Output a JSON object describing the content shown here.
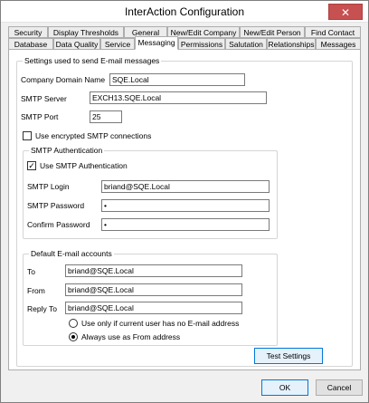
{
  "window": {
    "title": "InterAction Configuration",
    "close_glyph": "✕"
  },
  "tabs_row1": [
    "Security",
    "Display Thresholds",
    "General",
    "New/Edit Company",
    "New/Edit Person",
    "Find Contact"
  ],
  "tabs_row2": [
    "Database",
    "Data Quality",
    "Service",
    "Messaging",
    "Permissions",
    "Salutation",
    "Relationships",
    "Messages"
  ],
  "active_tab": "Messaging",
  "email_settings": {
    "legend": "Settings used to send E-mail messages",
    "company_domain_label": "Company Domain Name",
    "company_domain_value": "SQE.Local",
    "smtp_server_label": "SMTP Server",
    "smtp_server_value": "EXCH13.SQE.Local",
    "smtp_port_label": "SMTP Port",
    "smtp_port_value": "25",
    "encrypted_label": "Use encrypted SMTP connections",
    "encrypted_checked": false
  },
  "smtp_auth": {
    "legend": "SMTP Authentication",
    "use_auth_label": "Use SMTP Authentication",
    "use_auth_checked": true,
    "login_label": "SMTP Login",
    "login_value": "briand@SQE.Local",
    "password_label": "SMTP Password",
    "password_value": "•",
    "confirm_label": "Confirm Password",
    "confirm_value": "•"
  },
  "default_accounts": {
    "legend": "Default E-mail accounts",
    "to_label": "To",
    "to_value": "briand@SQE.Local",
    "from_label": "From",
    "from_value": "briand@SQE.Local",
    "reply_label": "Reply To",
    "reply_value": "briand@SQE.Local",
    "radio1_label": "Use only if current user has no E-mail address",
    "radio2_label": "Always use as From address",
    "selected_radio": 2
  },
  "buttons": {
    "test_settings": "Test Settings",
    "ok": "OK",
    "cancel": "Cancel"
  }
}
